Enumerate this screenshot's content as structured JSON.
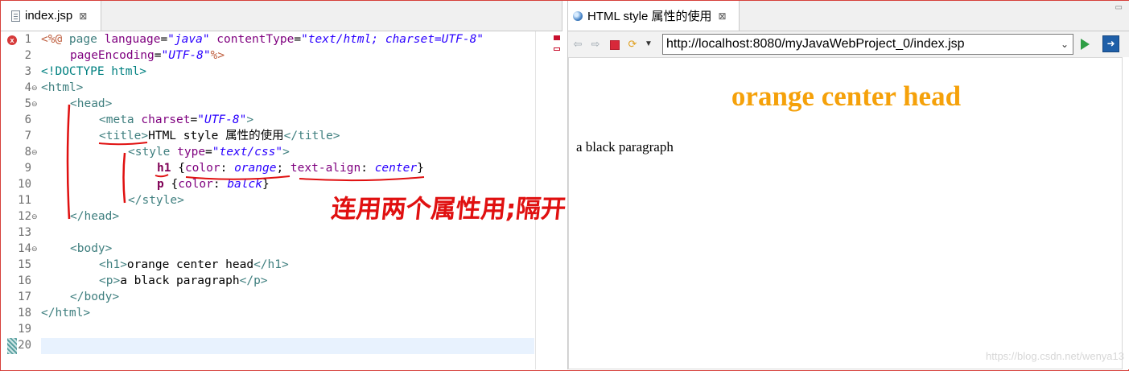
{
  "editor": {
    "tab_label": "index.jsp",
    "tab_close": "⊠",
    "line_numbers": [
      "1",
      "2",
      "3",
      "4",
      "5",
      "6",
      "7",
      "8",
      "9",
      "10",
      "11",
      "12",
      "13",
      "14",
      "15",
      "16",
      "17",
      "18",
      "19",
      "20"
    ],
    "fold_marker": "⊖",
    "error_glyph": "x",
    "code": {
      "l1_open": "<%@",
      "l1_page": " page ",
      "l1_lang_attr": "language",
      "l1_eq": "=",
      "l1_lang_val": "\"java\"",
      "l1_ct_attr": "contentType",
      "l1_ct_val": "\"text/html; charset=UTF-8\"",
      "l2_pe_attr": "pageEncoding",
      "l2_pe_val": "\"UTF-8\"",
      "l2_close": "%>",
      "l3": "<!DOCTYPE html>",
      "l4": "<html>",
      "l5": "<head>",
      "l6_open": "<meta",
      "l6_attr": "charset",
      "l6_val": "\"UTF-8\"",
      "l6_close": ">",
      "l7_open": "<title>",
      "l7_text": "HTML style 属性的使用",
      "l7_close": "</title>",
      "l8_open": "<style",
      "l8_attr": "type",
      "l8_val": "\"text/css\"",
      "l8_close": ">",
      "l9_sel": "h1",
      "l9_brace_open": " {",
      "l9_prop1": "color",
      "l9_val1": "orange",
      "l9_sep": "; ",
      "l9_prop2": "text-align",
      "l9_val2": "center",
      "l9_brace_close": "}",
      "l10_sel": "p",
      "l10_brace_open": " {",
      "l10_prop": "color",
      "l10_val": "balck",
      "l10_brace_close": "}",
      "l11": "</style>",
      "l12": "</head>",
      "l14": "<body>",
      "l15_open": "<h1>",
      "l15_text": "orange center head",
      "l15_close": "</h1>",
      "l16_open": "<p>",
      "l16_text": "a black paragraph",
      "l16_close": "</p>",
      "l17": "</body>",
      "l18": "</html>"
    },
    "annotation_text": "连用两个属性用;隔开"
  },
  "browser": {
    "tab_label": "HTML style 属性的使用",
    "tab_close": "⊠",
    "url": "http://localhost:8080/myJavaWebProject_0/index.jsp",
    "url_dropdown": "⌄",
    "page": {
      "heading": "orange center head",
      "paragraph": "a black paragraph",
      "heading_color": "#f5a10a"
    },
    "watermark": "https://blog.csdn.net/wenya13"
  },
  "colors": {
    "annotation_red": "#e01010",
    "accent_border": "#d6403a"
  }
}
